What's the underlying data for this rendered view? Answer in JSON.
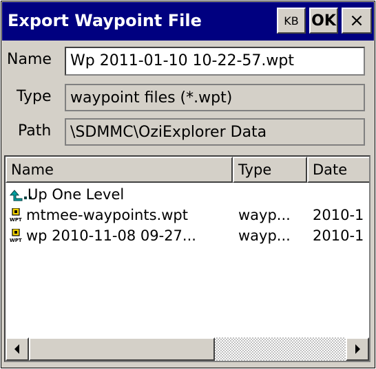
{
  "window": {
    "title": "Export Waypoint File",
    "buttons": {
      "kb": "KB",
      "ok": "OK",
      "close": "×"
    }
  },
  "form": {
    "name_label": "Name",
    "name_value": "Wp 2011-01-10 10-22-57.wpt",
    "type_label": "Type",
    "type_value": "waypoint files (*.wpt)",
    "path_label": "Path",
    "path_value": "\\SDMMC\\OziExplorer Data"
  },
  "list": {
    "columns": [
      "Name",
      "Type",
      "Date"
    ],
    "rows": [
      {
        "icon": "up-folder-icon",
        "name": "Up One Level",
        "type": "",
        "date": ""
      },
      {
        "icon": "wpt-file-icon",
        "name": "mtmee-waypoints.wpt",
        "type": "wayp...",
        "date": "2010-1"
      },
      {
        "icon": "wpt-file-icon",
        "name": "wp 2010-11-08 09-27...",
        "type": "wayp...",
        "date": "2010-1"
      }
    ]
  },
  "colors": {
    "titlebar": "#000080",
    "face": "#d4d0c8"
  }
}
